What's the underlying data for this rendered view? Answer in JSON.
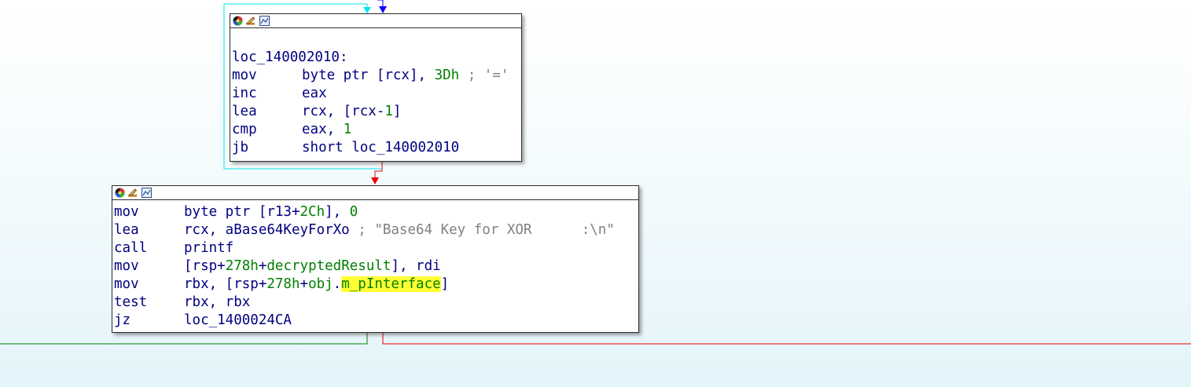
{
  "colors": {
    "text": "#000080",
    "number": "#008000",
    "comment": "#808080",
    "highlight": "#ffff33",
    "edge_cyan": "#00e5ee",
    "edge_blue": "#0000ff",
    "edge_red": "#ee0000",
    "edge_green": "#008000",
    "underline": "#e00000"
  },
  "node_top": {
    "header_icons": [
      "color-wheel-icon",
      "edit-pencil-icon",
      "graph-overview-icon"
    ],
    "label": "loc_140002010:",
    "lines": [
      {
        "mnemonic": "mov",
        "parts": [
          {
            "t": "byte ptr [rcx], ",
            "k": "op"
          },
          {
            "t": "3Dh",
            "k": "num"
          },
          {
            "t": " ; '='",
            "k": "cmt"
          }
        ]
      },
      {
        "mnemonic": "inc",
        "parts": [
          {
            "t": "eax",
            "k": "op"
          }
        ]
      },
      {
        "mnemonic": "lea",
        "parts": [
          {
            "t": "rcx, [rcx-",
            "k": "op"
          },
          {
            "t": "1",
            "k": "num"
          },
          {
            "t": "]",
            "k": "op"
          }
        ]
      },
      {
        "mnemonic": "cmp",
        "parts": [
          {
            "t": "eax, ",
            "k": "op"
          },
          {
            "t": "1",
            "k": "num"
          }
        ]
      },
      {
        "mnemonic": "jb",
        "parts": [
          {
            "t": "short loc_140002010",
            "k": "op"
          }
        ]
      }
    ]
  },
  "node_bottom": {
    "header_icons": [
      "color-wheel-icon",
      "edit-pencil-icon",
      "graph-overview-icon"
    ],
    "lines": [
      {
        "mnemonic": "mov",
        "parts": [
          {
            "t": "byte ptr [r13+",
            "k": "op"
          },
          {
            "t": "2Ch",
            "k": "num"
          },
          {
            "t": "], ",
            "k": "op"
          },
          {
            "t": "0",
            "k": "num"
          }
        ]
      },
      {
        "mnemonic": "lea",
        "parts": [
          {
            "t": "rcx, aBase64KeyForXo",
            "k": "op"
          },
          {
            "t": " ; \"Base64 Key for XOR      :\\n\"",
            "k": "cmt"
          }
        ]
      },
      {
        "mnemonic": "call",
        "parts": [
          {
            "t": "printf",
            "k": "op"
          }
        ]
      },
      {
        "mnemonic": "mov",
        "parts": [
          {
            "t": "[rsp+",
            "k": "op"
          },
          {
            "t": "278h",
            "k": "num"
          },
          {
            "t": "+",
            "k": "op"
          },
          {
            "t": "decryptedResult",
            "k": "num"
          },
          {
            "t": "], rdi",
            "k": "op"
          }
        ]
      },
      {
        "mnemonic": "mov",
        "parts": [
          {
            "t": "rbx, [rsp+",
            "k": "op"
          },
          {
            "t": "278h",
            "k": "num"
          },
          {
            "t": "+",
            "k": "op"
          },
          {
            "t": "obj",
            "k": "num"
          },
          {
            "t": ".",
            "k": "op"
          },
          {
            "t": "m_pInterface",
            "k": "hl"
          },
          {
            "t": "]",
            "k": "op"
          }
        ]
      },
      {
        "mnemonic": "test",
        "parts": [
          {
            "t": "rbx, rbx",
            "k": "op"
          }
        ]
      },
      {
        "mnemonic": "jz",
        "parts": [
          {
            "t": "loc_1400024CA",
            "k": "op"
          }
        ]
      }
    ]
  }
}
